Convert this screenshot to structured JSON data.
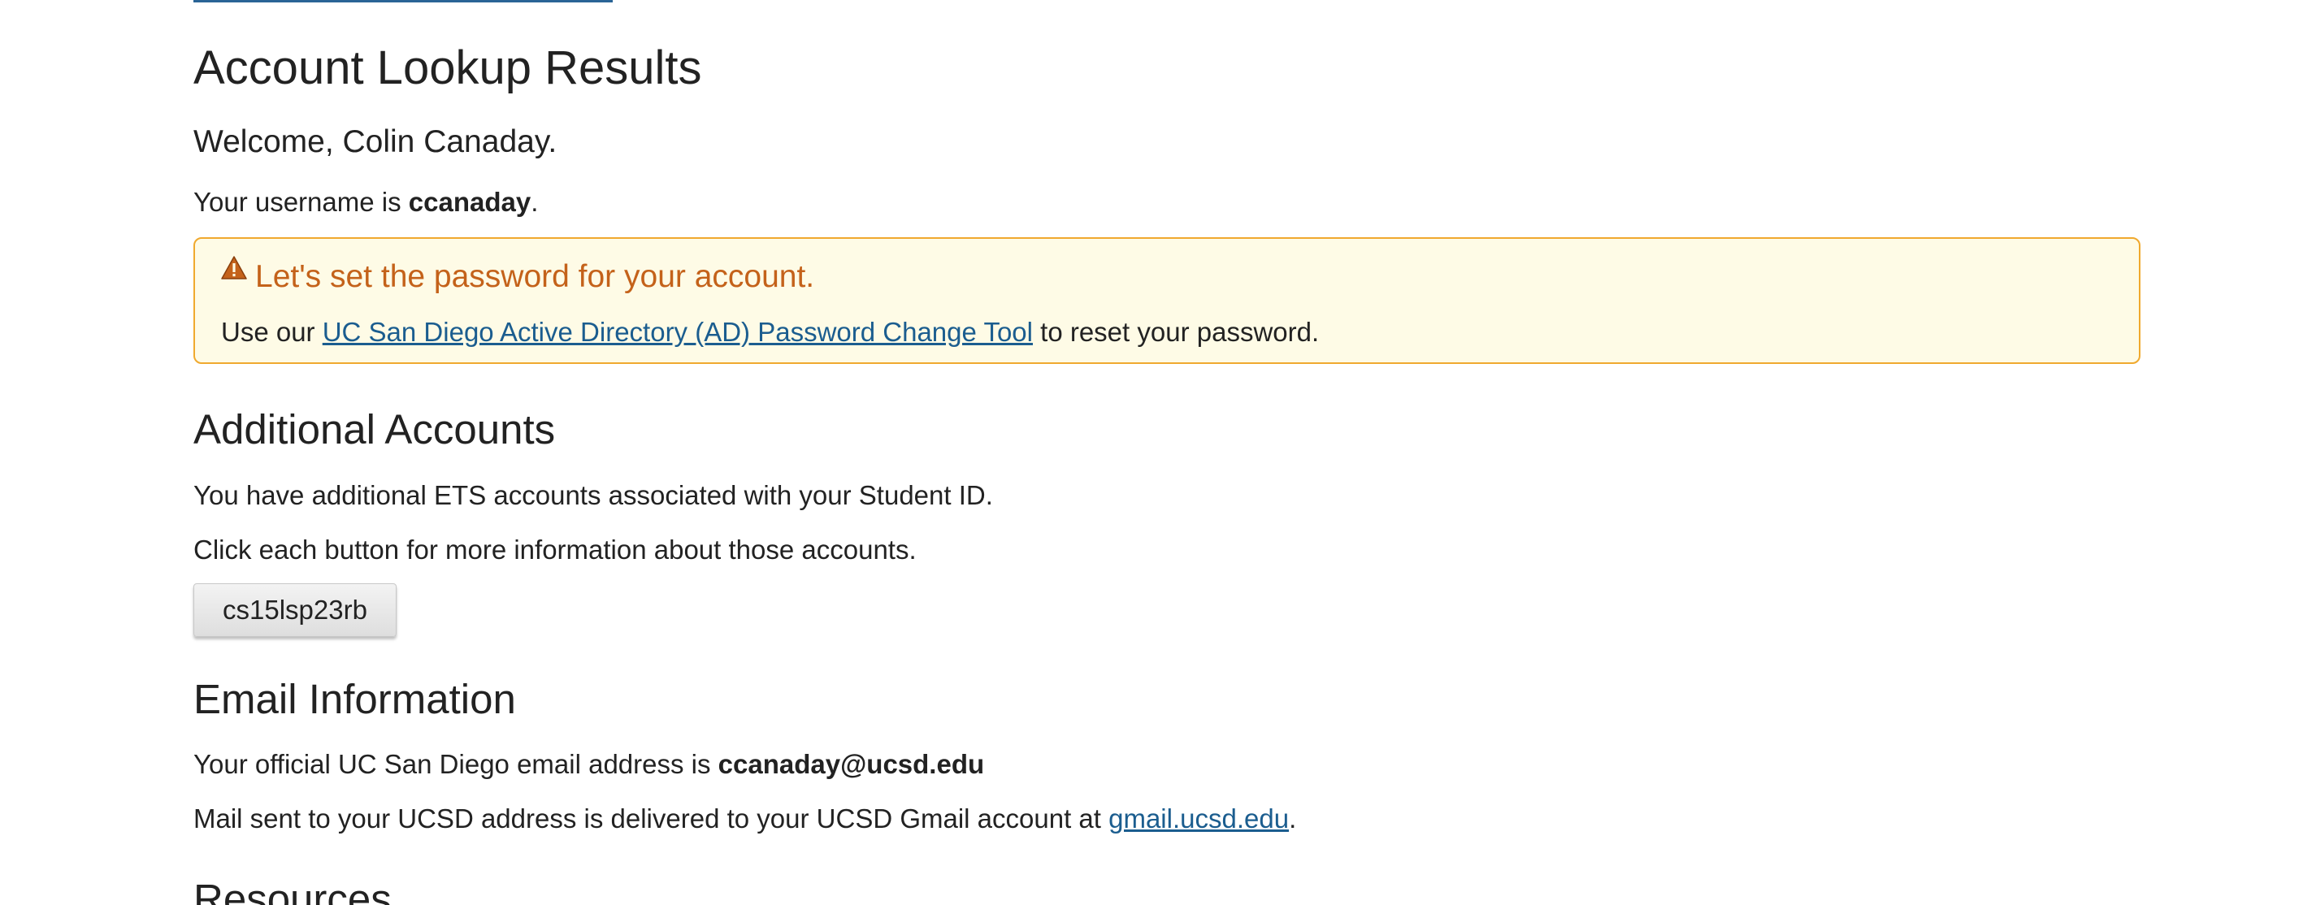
{
  "page": {
    "title": "Account Lookup Results",
    "welcome": "Welcome, Colin Canaday.",
    "username_prefix": "Your username is ",
    "username": "ccanaday",
    "username_suffix": "."
  },
  "alert": {
    "icon": "warning-icon",
    "title": "Let's set the password for your account.",
    "body_prefix": "Use our ",
    "link_text": "UC San Diego Active Directory (AD) Password Change Tool",
    "body_suffix": " to reset your password.",
    "border_color": "#f0a92e",
    "background_color": "#fefbe6",
    "title_color": "#c4621a"
  },
  "additional_accounts": {
    "heading": "Additional Accounts",
    "line1": "You have additional ETS accounts associated with your Student ID.",
    "line2": "Click each button for more information about those accounts.",
    "accounts": [
      "cs15lsp23rb"
    ]
  },
  "email": {
    "heading": "Email Information",
    "official_prefix": "Your official UC San Diego email address is ",
    "official_address": "ccanaday@ucsd.edu",
    "mail_prefix": "Mail sent to your UCSD address is delivered to your UCSD Gmail account at ",
    "gmail_link": "gmail.ucsd.edu",
    "mail_suffix": "."
  },
  "resources": {
    "heading": "Resources"
  },
  "colors": {
    "link": "#1b5d8f",
    "text": "#222222"
  }
}
